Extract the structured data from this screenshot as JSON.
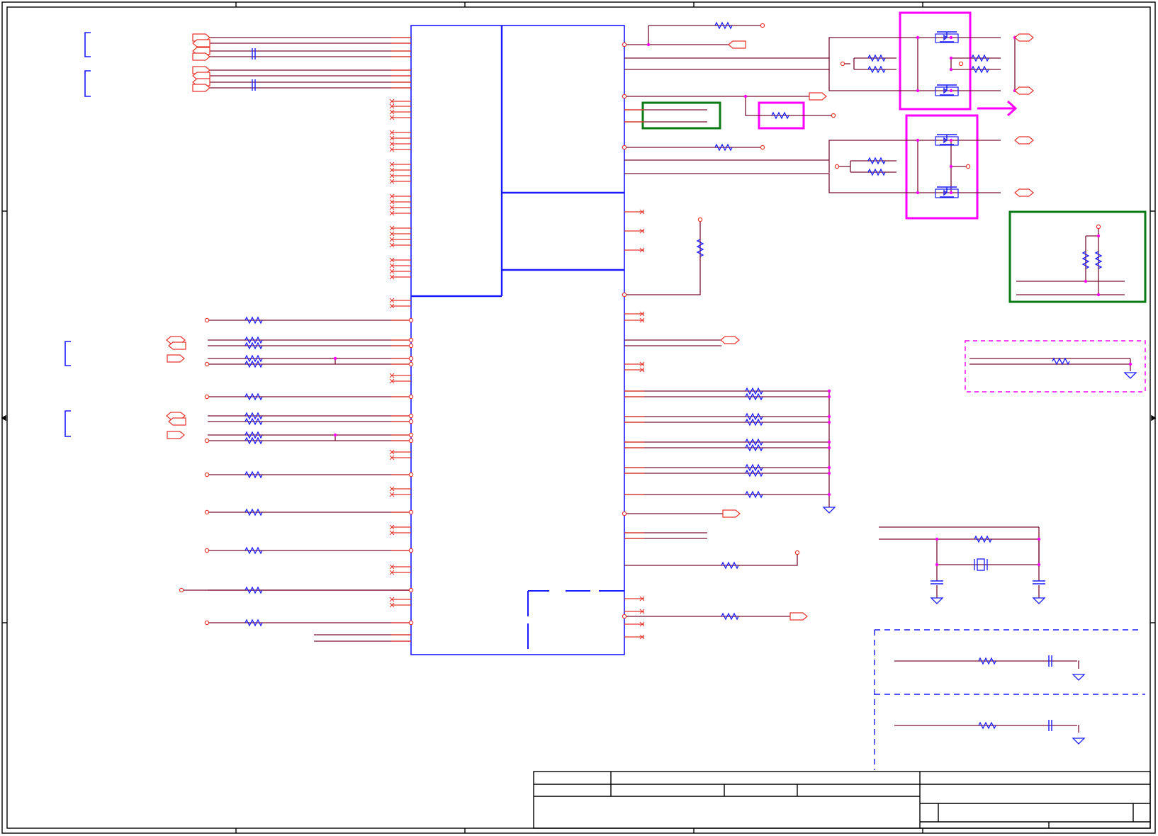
{
  "palette": {
    "frame": "#000000",
    "wire": "#7a1030",
    "pin": "#e8342c",
    "ic_body": "#1a1aff",
    "highlight_green": "#0a7a14",
    "highlight_magenta": "#ff00ff",
    "node_dot": "#ff00ff"
  }
}
